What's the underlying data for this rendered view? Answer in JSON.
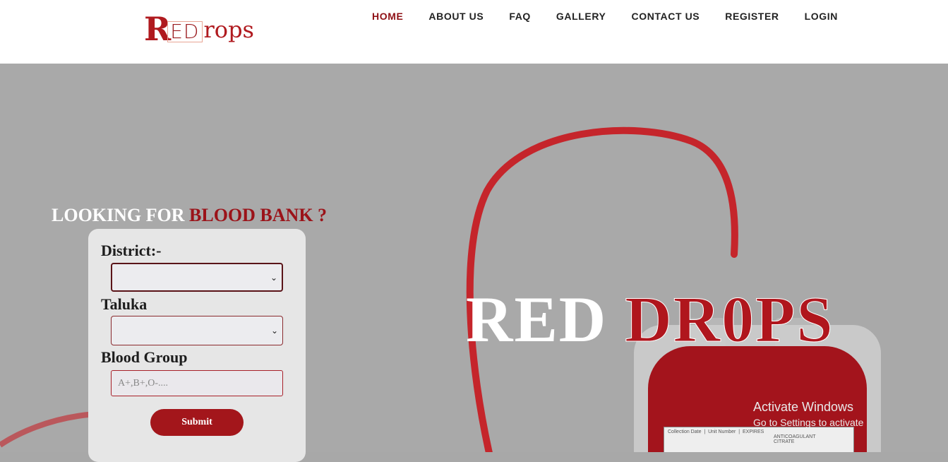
{
  "logo": {
    "part1": "R",
    "part2": "ED",
    "part3": "rops"
  },
  "nav": {
    "home": "HOME",
    "about": "ABOUT US",
    "faq": "FAQ",
    "gallery": "GALLERY",
    "contact": "CONTACT US",
    "register": "REGISTER",
    "login": "LOGIN"
  },
  "hero": {
    "title_white": "RED ",
    "title_red": "DR0PS"
  },
  "search": {
    "heading_white": "LOOKING FOR ",
    "heading_red": "BLOOD BANK ?",
    "district_label": "District:-",
    "district_value": "",
    "taluka_label": "Taluka",
    "taluka_value": "",
    "blood_group_label": "Blood Group",
    "blood_group_placeholder": "A+,B+,O-....",
    "submit_label": "Submit"
  },
  "bag": {
    "collection_date": "Collection Date",
    "unit_number": "Unit Number",
    "expires": "EXPIRES",
    "anticoagulant": "ANTICOAGULANT",
    "citrate": "CITRATE"
  },
  "watermark": {
    "line1": "Activate Windows",
    "line2": "Go to Settings to activate"
  },
  "colors": {
    "brand_red": "#a3161b",
    "active_nav": "#8f1116",
    "hero_bg": "#a9a9a9"
  }
}
